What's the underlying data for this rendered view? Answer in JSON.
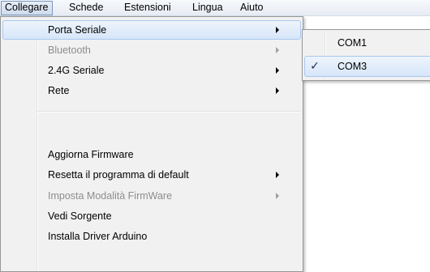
{
  "menubar": {
    "items": [
      {
        "label": "Collegare",
        "active": true
      },
      {
        "label": "Schede"
      },
      {
        "label": "Estensioni"
      },
      {
        "label": "Lingua"
      },
      {
        "label": "Aiuto"
      }
    ]
  },
  "menu": {
    "items": [
      {
        "label": "Porta Seriale",
        "submenu": true,
        "highlighted": true
      },
      {
        "label": "Bluetooth",
        "submenu": true,
        "disabled": true
      },
      {
        "label": "2.4G Seriale",
        "submenu": true
      },
      {
        "label": "Rete",
        "submenu": true
      },
      {
        "label": "Aggiorna Firmware"
      },
      {
        "label": "Resetta il programma di default",
        "submenu": true
      },
      {
        "label": "Imposta Modalità FirmWare",
        "submenu": true,
        "disabled": true
      },
      {
        "label": "Vedi Sorgente"
      },
      {
        "label": "Installa Driver Arduino"
      }
    ]
  },
  "submenu": {
    "items": [
      {
        "label": "COM1",
        "checked": false
      },
      {
        "label": "COM3",
        "checked": true,
        "highlighted": true
      }
    ],
    "check_glyph": "✓"
  },
  "icons": {
    "submenu_arrow": "chevron-right-icon",
    "checkmark": "check-icon"
  },
  "colors": {
    "highlight_border": "#a8c8ee",
    "disabled_text": "#8d8d8d",
    "menu_background": "#f1f1f1"
  }
}
